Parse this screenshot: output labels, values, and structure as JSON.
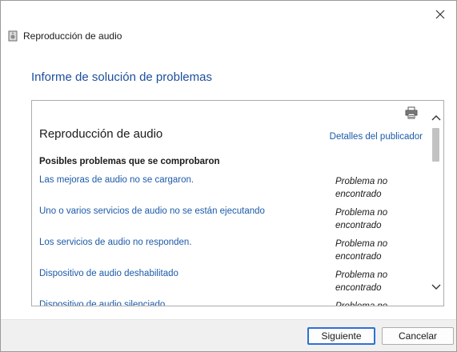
{
  "window": {
    "title": "Reproducción de audio"
  },
  "icons": {
    "app": "speaker-icon",
    "close": "close-icon",
    "print": "printer-icon",
    "scroll_up": "chevron-up-icon",
    "scroll_down": "chevron-down-icon"
  },
  "main": {
    "heading": "Informe de solución de problemas"
  },
  "report": {
    "title": "Reproducción de audio",
    "publisher_link": "Detalles del publicador",
    "checked_heading": "Posibles problemas que se comprobaron",
    "issues": [
      {
        "name": "Las mejoras de audio no se cargaron.",
        "status": "Problema no encontrado"
      },
      {
        "name": "Uno o varios servicios de audio no se están ejecutando",
        "status": "Problema no encontrado"
      },
      {
        "name": "Los servicios de audio no responden.",
        "status": "Problema no encontrado"
      },
      {
        "name": "Dispositivo de audio deshabilitado",
        "status": "Problema no encontrado"
      },
      {
        "name": "Dispositivo de audio silenciado",
        "status": "Problema no encontrado"
      }
    ]
  },
  "buttons": {
    "next": "Siguiente",
    "cancel": "Cancelar"
  },
  "colors": {
    "heading": "#1c4f9c",
    "link": "#1c5aa8",
    "accent_border": "#2f6fd6"
  }
}
